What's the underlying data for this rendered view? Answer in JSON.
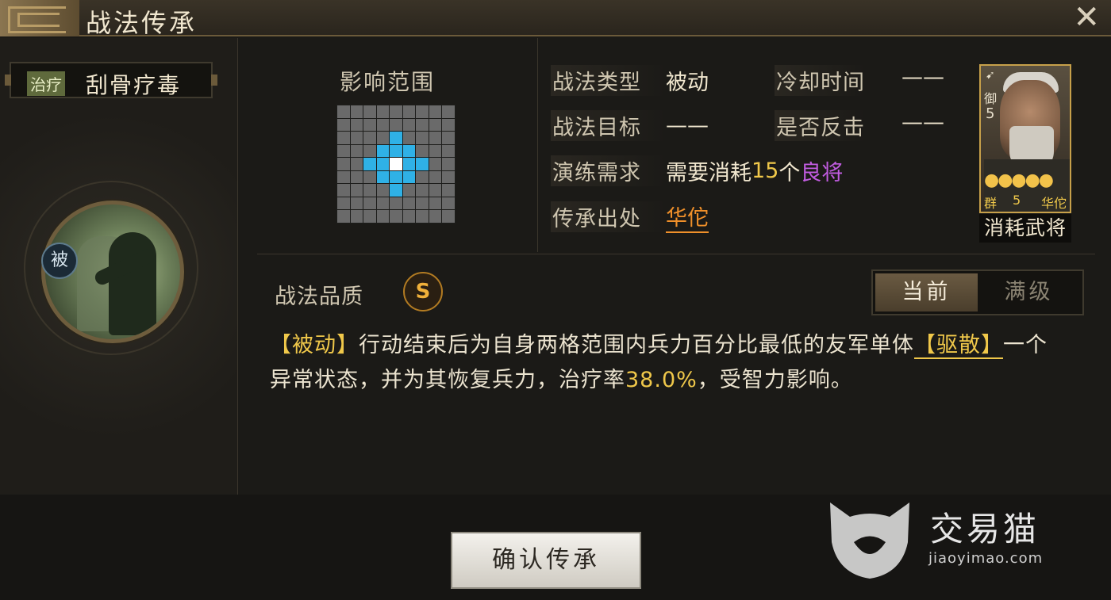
{
  "window": {
    "title": "战法传承"
  },
  "skill": {
    "tag": "治疗",
    "name": "刮骨疗毒",
    "type_badge": "被"
  },
  "range": {
    "title": "影响范围",
    "grid_size": 9,
    "self_cell": [
      4,
      4
    ],
    "hit_cells": [
      [
        2,
        4
      ],
      [
        3,
        3
      ],
      [
        3,
        4
      ],
      [
        3,
        5
      ],
      [
        4,
        2
      ],
      [
        4,
        3
      ],
      [
        4,
        5
      ],
      [
        4,
        6
      ],
      [
        5,
        3
      ],
      [
        5,
        4
      ],
      [
        5,
        5
      ],
      [
        6,
        4
      ]
    ]
  },
  "info": {
    "type_label": "战法类型",
    "type_value": "被动",
    "cooldown_label": "冷却时间",
    "cooldown_value": "——",
    "target_label": "战法目标",
    "target_value": "——",
    "counter_label": "是否反击",
    "counter_value": "——",
    "train_label": "演练需求",
    "train_prefix": "需要消耗",
    "train_count": "15",
    "train_unit": "个",
    "train_quality": "良将",
    "origin_label": "传承出处",
    "origin_value": "华佗"
  },
  "hero_card": {
    "troop": "御",
    "cost": "5",
    "stars": "●●●●●",
    "faction": "群",
    "faction_num": "5",
    "name": "华佗",
    "caption": "消耗武将"
  },
  "quality": {
    "label": "战法品质",
    "grade": "S"
  },
  "tabs": [
    {
      "label": "当前",
      "active": true
    },
    {
      "label": "满级",
      "active": false
    }
  ],
  "description": {
    "tag": "【被动】",
    "part1": "行动结束后为自身两格范围内兵力百分比最低的友军单体",
    "keyword": "【驱散】",
    "part2": "一个异常状态，并为其恢复兵力，治疗率",
    "rate": "38.0%",
    "part3": "，受智力影响。"
  },
  "actions": {
    "confirm_label": "确认传承"
  },
  "watermark": {
    "name": "交易猫",
    "url": "jiaoyimao.com"
  },
  "colors": {
    "accent_gold": "#f0c84a",
    "range_hit": "#2fb1e6",
    "purple": "#c15ce0",
    "orange": "#f0902a"
  }
}
